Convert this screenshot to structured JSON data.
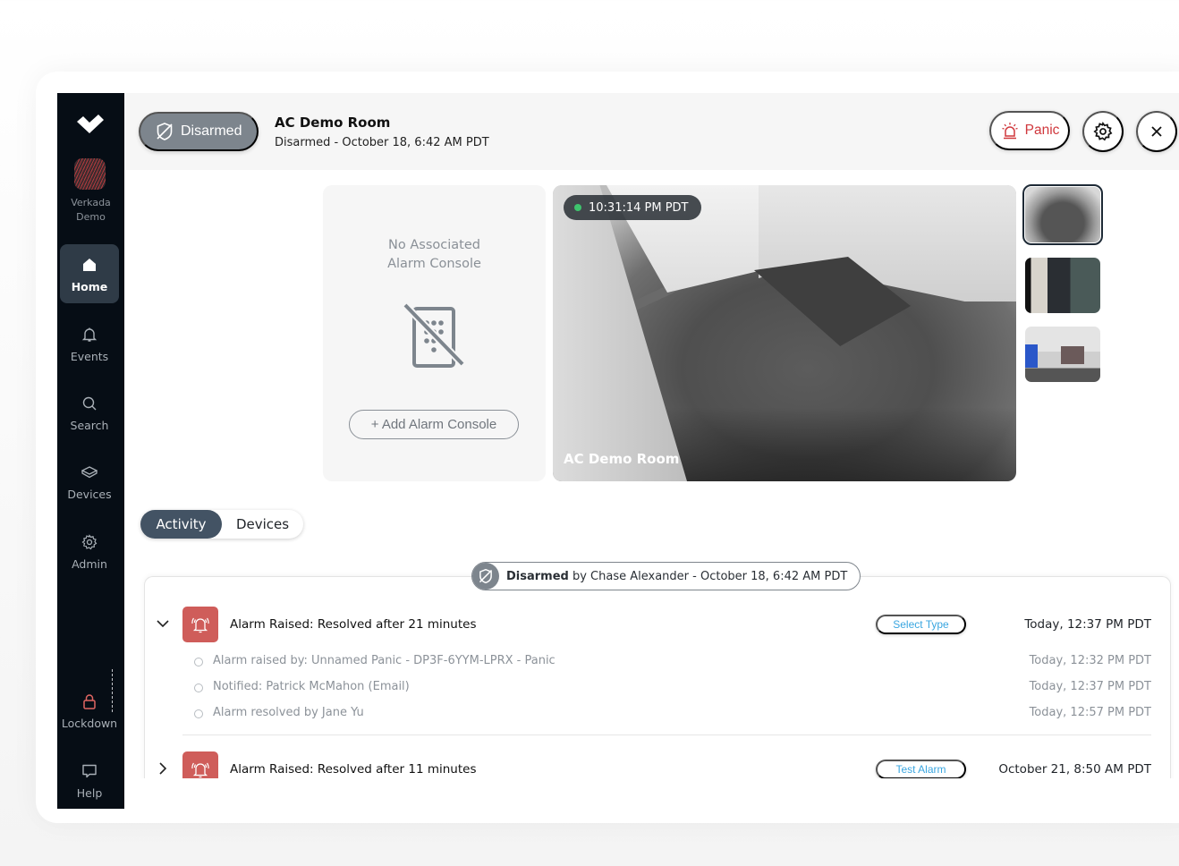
{
  "sidebar": {
    "org_name": "Verkada Demo",
    "items": [
      {
        "label": "Home",
        "icon": "home-icon",
        "active": true
      },
      {
        "label": "Events",
        "icon": "bell-icon"
      },
      {
        "label": "Search",
        "icon": "search-icon"
      },
      {
        "label": "Devices",
        "icon": "devices-icon"
      },
      {
        "label": "Admin",
        "icon": "gear-icon"
      },
      {
        "label": "Lockdown",
        "icon": "lock-icon"
      },
      {
        "label": "Help",
        "icon": "chat-icon"
      }
    ]
  },
  "header": {
    "status_label": "Disarmed",
    "title": "AC Demo Room",
    "subtitle": "Disarmed - October 18, 6:42 AM PDT",
    "panic_label": "Panic"
  },
  "console": {
    "message_line1": "No Associated",
    "message_line2": "Alarm Console",
    "add_label": "+ Add Alarm Console"
  },
  "camera": {
    "timestamp": "10:31:14 PM PDT",
    "name": "AC Demo Room",
    "live_color": "#3ec46d"
  },
  "tabs": [
    {
      "label": "Activity",
      "active": true
    },
    {
      "label": "Devices",
      "active": false
    }
  ],
  "activity": {
    "banner": {
      "status": "Disarmed",
      "detail": "by Chase Alexander - October 18, 6:42 AM PDT"
    },
    "events": [
      {
        "title": "Alarm Raised: Resolved after 21 minutes",
        "type_label": "Select Type",
        "time": "Today, 12:37 PM PDT",
        "expanded": true,
        "details": [
          {
            "text": "Alarm raised by: Unnamed Panic - DP3F-6YYM-LPRX - Panic",
            "time": "Today, 12:32 PM PDT"
          },
          {
            "text": "Notified: Patrick McMahon (Email)",
            "time": "Today, 12:37 PM PDT"
          },
          {
            "text": "Alarm resolved by Jane Yu",
            "time": "Today, 12:57 PM PDT"
          }
        ]
      },
      {
        "title": "Alarm Raised: Resolved after 11 minutes",
        "type_label": "Test Alarm",
        "time": "October 21, 8:50 AM PDT",
        "expanded": false
      }
    ]
  },
  "colors": {
    "sidebar_bg": "#060d15",
    "alarm_red": "#cf5d5a",
    "panic_red": "#d0383d",
    "tab_active": "#435364",
    "link_blue": "#3aa6e0"
  }
}
